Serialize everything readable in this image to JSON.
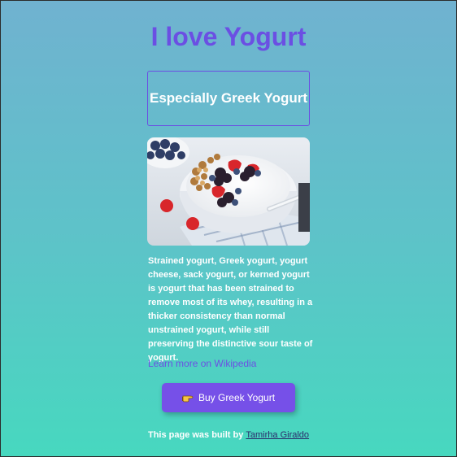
{
  "header": {
    "title": "I love Yogurt",
    "subtitle": "Especially Greek Yogurt"
  },
  "hero_image": {
    "alt": "bowl of greek yogurt with berries and granola",
    "icon": "yogurt-bowl-image"
  },
  "description": "Strained yogurt, Greek yogurt, yogurt cheese, sack yogurt, or kerned yogurt is yogurt that has been strained to remove most of its whey, resulting in a thicker consistency than normal unstrained yogurt, while still preserving the distinctive sour taste of yogurt.",
  "link": {
    "label": "Learn more on Wikipedia"
  },
  "cta": {
    "label": "Buy Greek Yogurt",
    "icon": "pointing-hand-icon"
  },
  "footer": {
    "prefix": "This page was built by ",
    "author": "Tamirha Giraldo"
  },
  "colors": {
    "accent": "#6b4fe3",
    "button": "#7650e8",
    "gradient_top": "#70b2d0",
    "gradient_bottom": "#47d8bf"
  }
}
